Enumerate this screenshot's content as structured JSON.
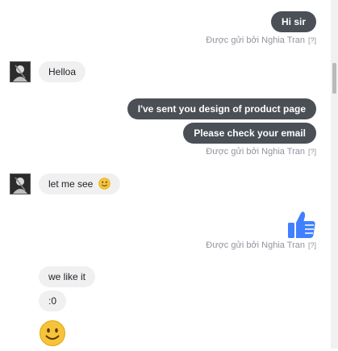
{
  "messages": {
    "m1": {
      "text": "Hi sir"
    },
    "m2": {
      "text": "Helloa"
    },
    "m3": {
      "text": "I've sent you design of product page"
    },
    "m4": {
      "text": "Please check your email"
    },
    "m5": {
      "text": "let me see"
    },
    "m7": {
      "text": "we like it"
    },
    "m8": {
      "text": ":0"
    }
  },
  "sent_by": {
    "label": "Được gửi bởi Nghia Tran",
    "help": "[?]"
  },
  "icons": {
    "avatar": "user-avatar-icon",
    "smiley_inline": "smiley-icon",
    "like": "thumbs-up-icon",
    "big_smiley": "smiley-icon"
  },
  "colors": {
    "outgoing_bubble": "#4b4f56",
    "incoming_bubble": "#f1f0f0",
    "like_blue": "#4080ff",
    "emoji_yellow": "#f7c33c"
  }
}
